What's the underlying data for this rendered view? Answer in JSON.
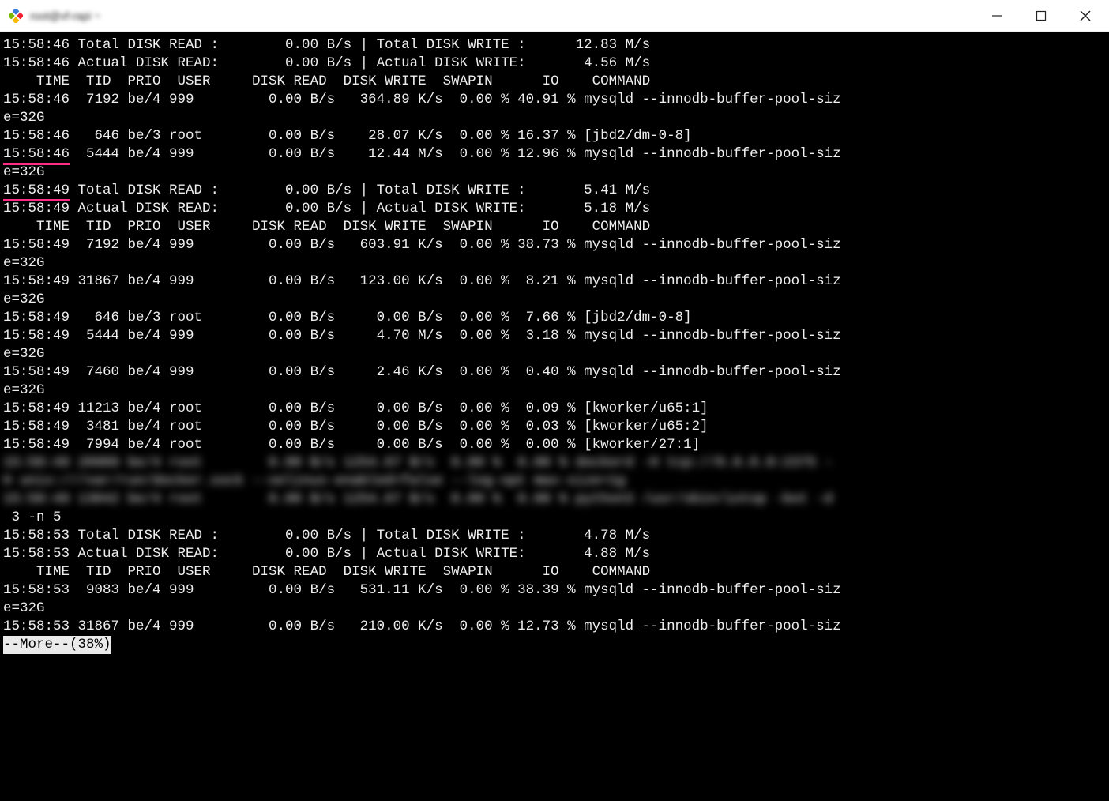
{
  "window": {
    "title": "root@vf-rapi ~"
  },
  "sections": [
    {
      "type": "summary",
      "time": "15:58:46",
      "total_read": "0.00 B/s",
      "total_write": "12.83 M/s",
      "actual_read": "0.00 B/s",
      "actual_write": "4.56 M/s",
      "header": "    TIME  TID  PRIO  USER     DISK READ  DISK WRITE  SWAPIN      IO    COMMAND",
      "rows": [
        {
          "time": "15:58:46",
          "tid": "7192",
          "prio": "be/4",
          "user": "999",
          "read": "0.00 B/s",
          "write": "364.89 K/s",
          "swapin": "0.00 %",
          "io": "40.91 %",
          "command": "mysqld --innodb-buffer-pool-size=32G",
          "wrap": true,
          "mark": false
        },
        {
          "time": "15:58:46",
          "tid": "646",
          "prio": "be/3",
          "user": "root",
          "read": "0.00 B/s",
          "write": "28.07 K/s",
          "swapin": "0.00 %",
          "io": "16.37 %",
          "command": "[jbd2/dm-0-8]",
          "wrap": false,
          "mark": false
        },
        {
          "time": "15:58:46",
          "tid": "5444",
          "prio": "be/4",
          "user": "999",
          "read": "0.00 B/s",
          "write": "12.44 M/s",
          "swapin": "0.00 %",
          "io": "12.96 %",
          "command": "mysqld --innodb-buffer-pool-size=32G",
          "wrap": true,
          "mark": true
        }
      ]
    },
    {
      "type": "summary",
      "time": "15:58:49",
      "mark_summary": true,
      "total_read": "0.00 B/s",
      "total_write": "5.41 M/s",
      "actual_read": "0.00 B/s",
      "actual_write": "5.18 M/s",
      "header": "    TIME  TID  PRIO  USER     DISK READ  DISK WRITE  SWAPIN      IO    COMMAND",
      "rows": [
        {
          "time": "15:58:49",
          "tid": "7192",
          "prio": "be/4",
          "user": "999",
          "read": "0.00 B/s",
          "write": "603.91 K/s",
          "swapin": "0.00 %",
          "io": "38.73 %",
          "command": "mysqld --innodb-buffer-pool-size=32G",
          "wrap": true
        },
        {
          "time": "15:58:49",
          "tid": "31867",
          "prio": "be/4",
          "user": "999",
          "read": "0.00 B/s",
          "write": "123.00 K/s",
          "swapin": "0.00 %",
          "io": "8.21 %",
          "command": "mysqld --innodb-buffer-pool-size=32G",
          "wrap": true
        },
        {
          "time": "15:58:49",
          "tid": "646",
          "prio": "be/3",
          "user": "root",
          "read": "0.00 B/s",
          "write": "0.00 B/s",
          "swapin": "0.00 %",
          "io": "7.66 %",
          "command": "[jbd2/dm-0-8]",
          "wrap": false
        },
        {
          "time": "15:58:49",
          "tid": "5444",
          "prio": "be/4",
          "user": "999",
          "read": "0.00 B/s",
          "write": "4.70 M/s",
          "swapin": "0.00 %",
          "io": "3.18 %",
          "command": "mysqld --innodb-buffer-pool-size=32G",
          "wrap": true
        },
        {
          "time": "15:58:49",
          "tid": "7460",
          "prio": "be/4",
          "user": "999",
          "read": "0.00 B/s",
          "write": "2.46 K/s",
          "swapin": "0.00 %",
          "io": "0.40 %",
          "command": "mysqld --innodb-buffer-pool-size=32G",
          "wrap": true
        },
        {
          "time": "15:58:49",
          "tid": "11213",
          "prio": "be/4",
          "user": "root",
          "read": "0.00 B/s",
          "write": "0.00 B/s",
          "swapin": "0.00 %",
          "io": "0.09 %",
          "command": "[kworker/u65:1]",
          "wrap": false
        },
        {
          "time": "15:58:49",
          "tid": "3481",
          "prio": "be/4",
          "user": "root",
          "read": "0.00 B/s",
          "write": "0.00 B/s",
          "swapin": "0.00 %",
          "io": "0.03 %",
          "command": "[kworker/u65:2]",
          "wrap": false
        },
        {
          "time": "15:58:49",
          "tid": "7994",
          "prio": "be/4",
          "user": "root",
          "read": "0.00 B/s",
          "write": "0.00 B/s",
          "swapin": "0.00 %",
          "io": "0.00 %",
          "command": "[kworker/27:1]",
          "wrap": false
        }
      ]
    }
  ],
  "blurred_lines": [
    "15:58:49 20909 be/4 root        0.00 B/s 1254.67 B/s  0.00 %  0.00 % dockerd -H tcp://0.0.0.0:2375 -",
    "H unix:///var/run/docker.sock --selinux-enabled=false --log-opt max-size=1g",
    "15:58:49 13042 be/4 root        0.00 B/s 1254.67 B/s  0.00 %  0.00 % python3 /usr/sbin/iotop -bot -d"
  ],
  "post_blur_line": " 3 -n 5",
  "section3": {
    "time": "15:58:53",
    "total_read": "0.00 B/s",
    "total_write": "4.78 M/s",
    "actual_read": "0.00 B/s",
    "actual_write": "4.88 M/s",
    "header": "    TIME  TID  PRIO  USER     DISK READ  DISK WRITE  SWAPIN      IO    COMMAND",
    "rows": [
      {
        "time": "15:58:53",
        "tid": "9083",
        "prio": "be/4",
        "user": "999",
        "read": "0.00 B/s",
        "write": "531.11 K/s",
        "swapin": "0.00 %",
        "io": "38.39 %",
        "command": "mysqld --innodb-buffer-pool-size=32G",
        "wrap": true
      },
      {
        "time": "15:58:53",
        "tid": "31867",
        "prio": "be/4",
        "user": "999",
        "read": "0.00 B/s",
        "write": "210.00 K/s",
        "swapin": "0.00 %",
        "io": "12.73 %",
        "command": "mysqld --innodb-buffer-pool-siz",
        "wrap": false
      }
    ]
  },
  "more_prompt": "--More--(38%)"
}
